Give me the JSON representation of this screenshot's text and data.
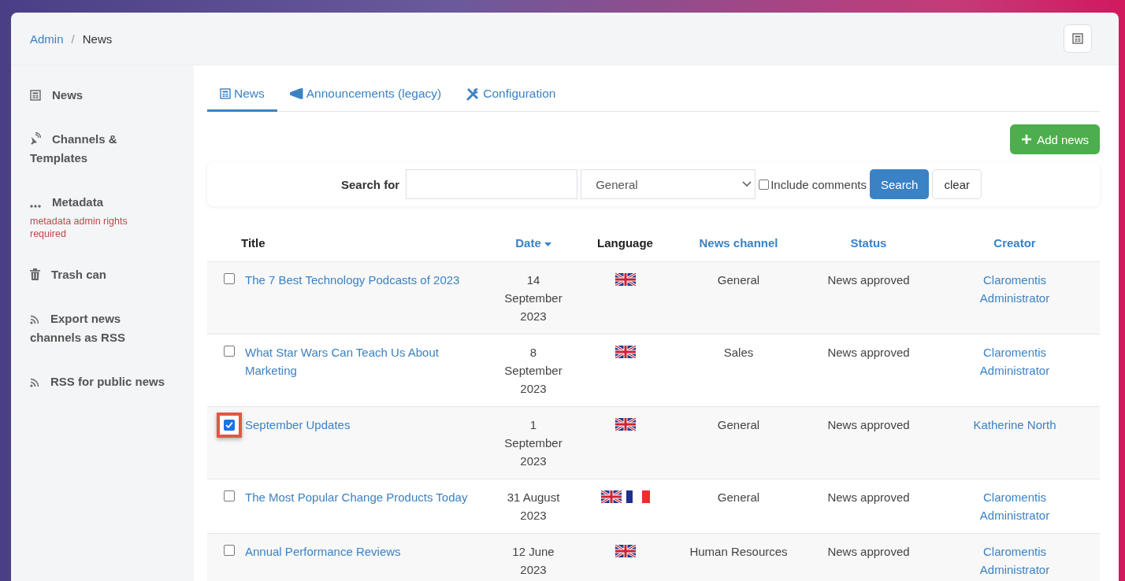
{
  "breadcrumb": [
    {
      "label": "Admin",
      "kind": "link"
    },
    {
      "label": "/",
      "kind": "separator"
    },
    {
      "label": "News",
      "kind": "current"
    }
  ],
  "sidebar": {
    "items": [
      {
        "label": "News"
      },
      {
        "label": "Channels & Templates"
      },
      {
        "label": "Metadata",
        "note": "metadata admin rights required"
      },
      {
        "label": "Trash can"
      },
      {
        "label": "Export news channels as RSS"
      },
      {
        "label": "RSS for public news"
      }
    ]
  },
  "tabs": [
    {
      "label": "News",
      "selected": true
    },
    {
      "label": "Announcements (legacy)",
      "selected": false
    },
    {
      "label": "Configuration",
      "selected": false
    }
  ],
  "add_button": "Add news",
  "search": {
    "label": "Search for",
    "channel": "General",
    "include_comments": {
      "label": "Include comments",
      "checked": false
    },
    "search_button": "Search",
    "clear_button": "clear"
  },
  "table": {
    "columns": [
      {
        "label": "Title",
        "link": false,
        "sorted": false
      },
      {
        "label": "Date",
        "link": true,
        "sorted": true
      },
      {
        "label": "Language",
        "link": false,
        "sorted": false
      },
      {
        "label": "News channel",
        "link": true,
        "sorted": false
      },
      {
        "label": "Status",
        "link": true,
        "sorted": false
      },
      {
        "label": "Creator",
        "link": true,
        "sorted": false
      }
    ],
    "rows": [
      {
        "checked": false,
        "highlighted": false,
        "title": "The 7 Best Technology Podcasts of 2023",
        "date": "14 September 2023",
        "languages": [
          {
            "kind": "uk"
          }
        ],
        "channel": "General",
        "status": "News approved",
        "creator": "Claromentis Administrator"
      },
      {
        "checked": false,
        "highlighted": false,
        "title": "What Star Wars Can Teach Us About Marketing",
        "date": "8 September 2023",
        "languages": [
          {
            "kind": "uk"
          }
        ],
        "channel": "Sales",
        "status": "News approved",
        "creator": "Claromentis Administrator"
      },
      {
        "checked": true,
        "highlighted": true,
        "title": "September Updates",
        "date": "1 September 2023",
        "languages": [
          {
            "kind": "uk"
          }
        ],
        "channel": "General",
        "status": "News approved",
        "creator": "Katherine North"
      },
      {
        "checked": false,
        "highlighted": false,
        "title": "The Most Popular Change Products Today",
        "date": "31 August 2023",
        "languages": [
          {
            "kind": "uk"
          },
          {
            "kind": "fr"
          }
        ],
        "channel": "General",
        "status": "News approved",
        "creator": "Claromentis Administrator"
      },
      {
        "checked": false,
        "highlighted": false,
        "title": "Annual Performance Reviews",
        "date": "12 June 2023",
        "languages": [
          {
            "kind": "uk"
          }
        ],
        "channel": "Human Resources",
        "status": "News approved",
        "creator": "Claromentis Administrator"
      }
    ]
  }
}
